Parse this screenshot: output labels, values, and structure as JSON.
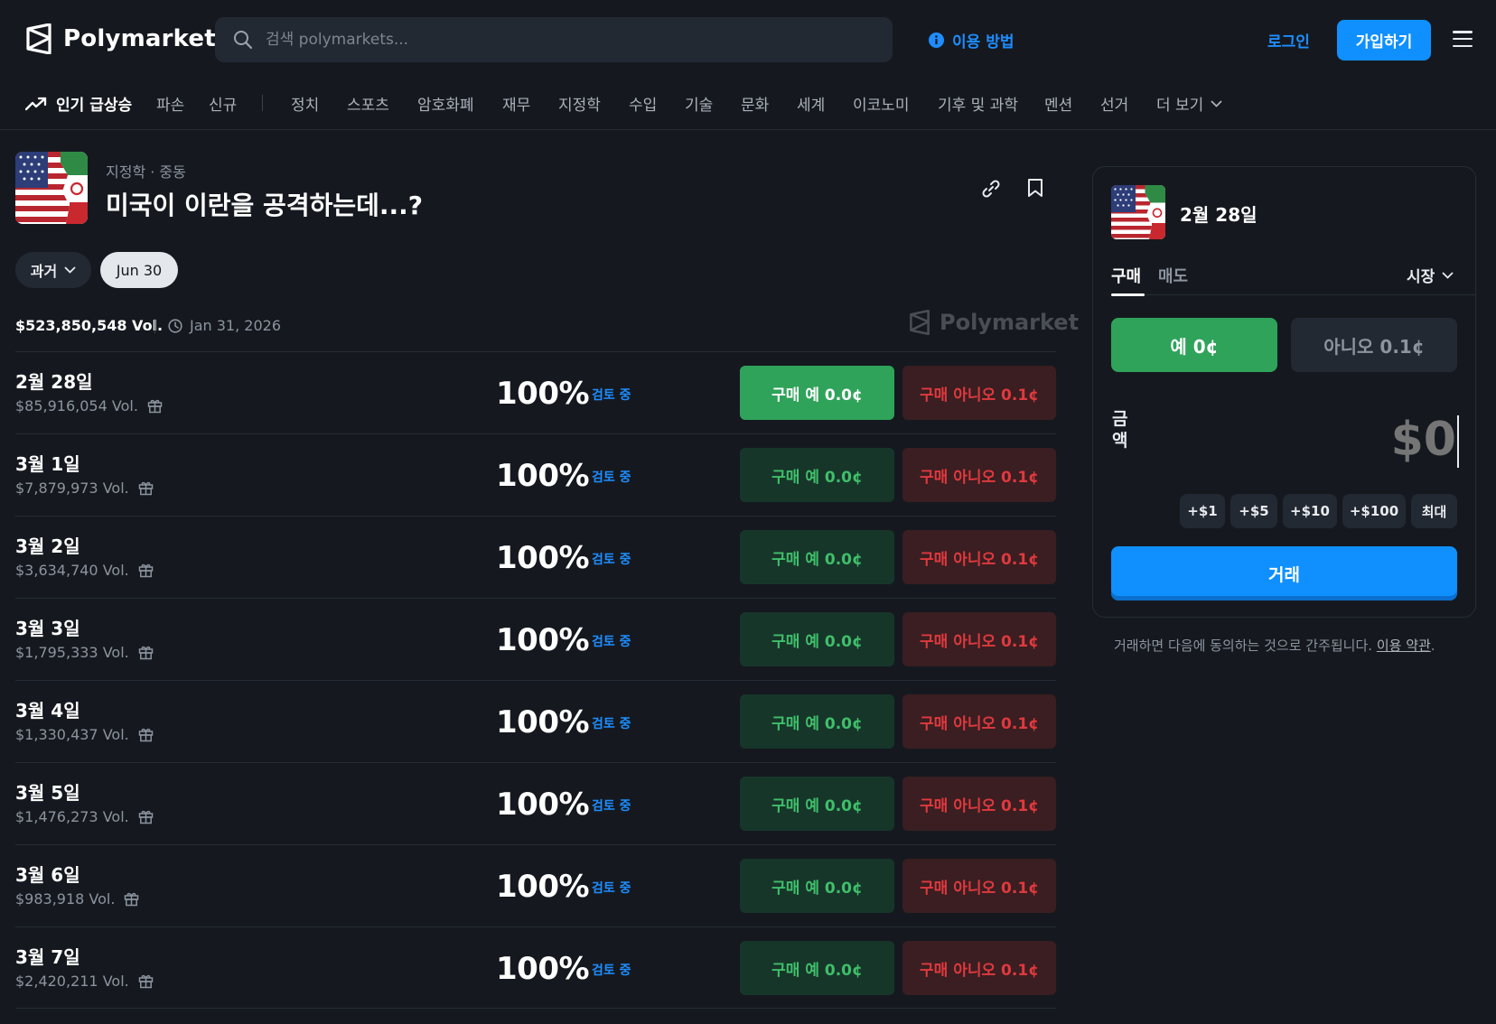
{
  "header": {
    "brand": "Polymarket",
    "search_placeholder": "검색 polymarkets...",
    "how_it_works": "이용 방법",
    "login": "로그인",
    "signup": "가입하기"
  },
  "nav": {
    "trending": "인기 급상승",
    "items": [
      "파손",
      "신규",
      "정치",
      "스포츠",
      "암호화폐",
      "재무",
      "지정학",
      "수입",
      "기술",
      "문화",
      "세계",
      "이코노미",
      "기후 및 과학",
      "멘션",
      "선거",
      "더 보기"
    ]
  },
  "market": {
    "breadcrumb": "지정학 · 중동",
    "title": "미국이 이란을 공격하는데...?",
    "past_label": "과거",
    "date_chip": "Jun 30",
    "total_volume": "$523,850,548 Vol.",
    "end_date": "Jan 31, 2026",
    "watermark": "Polymarket"
  },
  "outcomes": [
    {
      "label": "2월 28일",
      "volume": "$85,916,054 Vol.",
      "percent": "100%",
      "status": "검토 중",
      "yes": "구매 예 0.0¢",
      "no": "구매 아니오 0.1¢"
    },
    {
      "label": "3월 1일",
      "volume": "$7,879,973 Vol.",
      "percent": "100%",
      "status": "검토 중",
      "yes": "구매 예 0.0¢",
      "no": "구매 아니오 0.1¢"
    },
    {
      "label": "3월 2일",
      "volume": "$3,634,740 Vol.",
      "percent": "100%",
      "status": "검토 중",
      "yes": "구매 예 0.0¢",
      "no": "구매 아니오 0.1¢"
    },
    {
      "label": "3월 3일",
      "volume": "$1,795,333 Vol.",
      "percent": "100%",
      "status": "검토 중",
      "yes": "구매 예 0.0¢",
      "no": "구매 아니오 0.1¢"
    },
    {
      "label": "3월 4일",
      "volume": "$1,330,437 Vol.",
      "percent": "100%",
      "status": "검토 중",
      "yes": "구매 예 0.0¢",
      "no": "구매 아니오 0.1¢"
    },
    {
      "label": "3월 5일",
      "volume": "$1,476,273 Vol.",
      "percent": "100%",
      "status": "검토 중",
      "yes": "구매 예 0.0¢",
      "no": "구매 아니오 0.1¢"
    },
    {
      "label": "3월 6일",
      "volume": "$983,918 Vol.",
      "percent": "100%",
      "status": "검토 중",
      "yes": "구매 예 0.0¢",
      "no": "구매 아니오 0.1¢"
    },
    {
      "label": "3월 7일",
      "volume": "$2,420,211 Vol.",
      "percent": "100%",
      "status": "검토 중",
      "yes": "구매 예 0.0¢",
      "no": "구매 아니오 0.1¢"
    }
  ],
  "trade": {
    "title": "2월 28일",
    "tab_buy": "구매",
    "tab_sell": "매도",
    "order_type": "시장",
    "yes_label": "예 0¢",
    "no_label": "아니오 0.1¢",
    "amount_label": "금액",
    "amount_placeholder": "$0",
    "quick_amounts": [
      "+$1",
      "+$5",
      "+$10",
      "+$100",
      "최대"
    ],
    "trade_button": "거래",
    "terms_prefix": "거래하면 다음에 동의하는 것으로 간주됩니다.",
    "terms_link": "이용 약관",
    "terms_suffix": "."
  },
  "colors": {
    "background": "#15191f",
    "accent_blue": "#1090ff",
    "yes_green": "#2fa35a",
    "no_red": "#e0393e"
  }
}
